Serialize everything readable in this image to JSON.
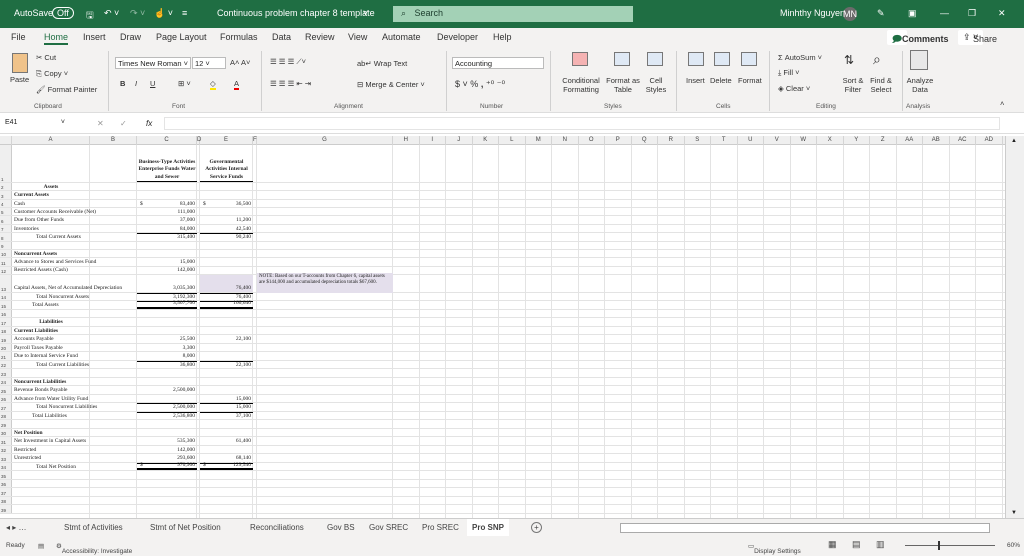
{
  "titlebar": {
    "autosave": "AutoSave",
    "autosave_state": "Off",
    "doc_title": "Continuous problem chapter 8 template",
    "search": "Search",
    "user": "Minhthy Nguyen",
    "initials": "MN"
  },
  "menu": {
    "tabs": [
      "File",
      "Home",
      "Insert",
      "Draw",
      "Page Layout",
      "Formulas",
      "Data",
      "Review",
      "View",
      "Automate",
      "Developer",
      "Help"
    ],
    "active": "Home",
    "comments": "Comments",
    "share": "Share"
  },
  "ribbon": {
    "clipboard": {
      "paste": "Paste",
      "cut": "Cut",
      "copy": "Copy",
      "format_painter": "Format Painter",
      "group": "Clipboard"
    },
    "font": {
      "name": "Times New Roman",
      "size": "12",
      "bold": "B",
      "italic": "I",
      "underline": "U",
      "group": "Font"
    },
    "alignment": {
      "wrap": "Wrap Text",
      "merge": "Merge & Center",
      "group": "Alignment"
    },
    "number": {
      "format": "Accounting",
      "currency": "$",
      "percent": "%",
      "comma": ",",
      "group": "Number"
    },
    "styles": {
      "conditional": "Conditional Formatting",
      "format_table": "Format as Table",
      "cell_styles": "Cell Styles",
      "group": "Styles"
    },
    "cells": {
      "insert": "Insert",
      "delete": "Delete",
      "format": "Format",
      "group": "Cells"
    },
    "editing": {
      "autosum": "AutoSum",
      "fill": "Fill",
      "clear": "Clear",
      "sort": "Sort & Filter",
      "find": "Find & Select",
      "group": "Editing"
    },
    "analysis": {
      "analyze": "Analyze Data",
      "group": "Analysis"
    }
  },
  "formula_bar": {
    "name_box": "E41",
    "fx": "fx",
    "value": ""
  },
  "columns": [
    "A",
    "B",
    "C",
    "D",
    "E",
    "F",
    "G",
    "H",
    "I",
    "J",
    "K",
    "L",
    "M",
    "N",
    "O",
    "P",
    "Q",
    "R",
    "S",
    "T",
    "U",
    "V",
    "W",
    "X",
    "Y",
    "Z",
    "AA",
    "AB",
    "AC",
    "AD",
    "AE"
  ],
  "header": {
    "c": "Business-Type Activities Enterprise Funds Water and Sewer",
    "e": "Governmental Activities Internal Service Funds"
  },
  "rows": [
    {
      "n": "2",
      "a": "Assets",
      "style": "heading-center"
    },
    {
      "n": "3",
      "a": "Current Assets",
      "style": "bold"
    },
    {
      "n": "4",
      "a": "Cash",
      "c": "83,400",
      "e": "36,500",
      "dollar": true
    },
    {
      "n": "5",
      "a": "Customer Accounts Receivable (Net)",
      "c": "111,000"
    },
    {
      "n": "6",
      "a": "Due from Other Funds",
      "c": "37,000",
      "e": "11,200"
    },
    {
      "n": "7",
      "a": "Inventories",
      "c": "84,000",
      "e": "42,540"
    },
    {
      "n": "8",
      "a": "Total Current Assets",
      "c": "315,400",
      "e": "90,240",
      "style": "total"
    },
    {
      "n": "9"
    },
    {
      "n": "10",
      "a": "Noncurrent Assets",
      "style": "bold"
    },
    {
      "n": "11",
      "a": "Advance to Stores and Services Fund",
      "c": "15,000"
    },
    {
      "n": "12",
      "a": "Restricted Assets (Cash)",
      "c": "142,000"
    },
    {
      "n": "13",
      "a": "Capital Assets, Net of Accumulated Depreciation",
      "c": "3,035,300",
      "e": "76,400",
      "style": "tall"
    },
    {
      "n": "14",
      "a": "Total Noncurrent Assets",
      "c": "3,192,300",
      "e": "76,400",
      "style": "total"
    },
    {
      "n": "15",
      "a": "Total Assets",
      "c": "3,507,700",
      "e": "166,640",
      "style": "grand"
    },
    {
      "n": "16"
    },
    {
      "n": "17",
      "a": "Liabilities",
      "style": "heading-center"
    },
    {
      "n": "18",
      "a": "Current Liabilities",
      "style": "bold"
    },
    {
      "n": "19",
      "a": "Accounts Payable",
      "c": "25,500",
      "e": "22,100"
    },
    {
      "n": "20",
      "a": "Payroll Taxes Payable",
      "c": "3,300"
    },
    {
      "n": "21",
      "a": "Due to Internal Service Fund",
      "c": "8,000"
    },
    {
      "n": "22",
      "a": "Total Current Liabilities",
      "c": "36,800",
      "e": "22,100",
      "style": "total"
    },
    {
      "n": "23"
    },
    {
      "n": "24",
      "a": "Noncurrent Liabilities",
      "style": "bold"
    },
    {
      "n": "25",
      "a": "Revenue Bonds Payable",
      "c": "2,500,000"
    },
    {
      "n": "26",
      "a": "Advance from Water Utility Fund",
      "e": "15,000"
    },
    {
      "n": "27",
      "a": "Total Noncurrent Liabilities",
      "c": "2,500,000",
      "e": "15,000",
      "style": "total"
    },
    {
      "n": "28",
      "a": "Total Liabilities",
      "c": "2,536,800",
      "e": "37,100",
      "style": "total"
    },
    {
      "n": "29"
    },
    {
      "n": "30",
      "a": "Net Position",
      "style": "bold"
    },
    {
      "n": "31",
      "a": "Net Investment in Capital Assets",
      "c": "535,300",
      "e": "61,400"
    },
    {
      "n": "32",
      "a": "Restricted",
      "c": "142,000"
    },
    {
      "n": "33",
      "a": "Unrestricted",
      "c": "293,600",
      "e": "68,140"
    },
    {
      "n": "34",
      "a": "Total Net Position",
      "c": "970,900",
      "e": "129,540",
      "dollar": true,
      "style": "grand"
    },
    {
      "n": "35"
    },
    {
      "n": "36"
    },
    {
      "n": "37"
    },
    {
      "n": "38"
    },
    {
      "n": "39"
    }
  ],
  "note": "NOTE: Based on our T-accounts from Chapter 6, capital assets are $144,000 and accumulated depreciation totals $67,600.",
  "dollar_sign": "$",
  "sheet_tabs": [
    "Stmt of Activities",
    "Stmt of Net Position",
    "Reconciliations",
    "Gov BS",
    "Gov SREC",
    "Pro SREC",
    "Pro SNP"
  ],
  "active_sheet": "Pro SNP",
  "status": {
    "ready": "Ready",
    "accessibility": "Accessibility: Investigate",
    "display_settings": "Display Settings",
    "zoom": "60%",
    "zoom_level_percent": 60
  },
  "colors": {
    "brand": "#1f6e43",
    "note_fill": "#e4dfec"
  }
}
